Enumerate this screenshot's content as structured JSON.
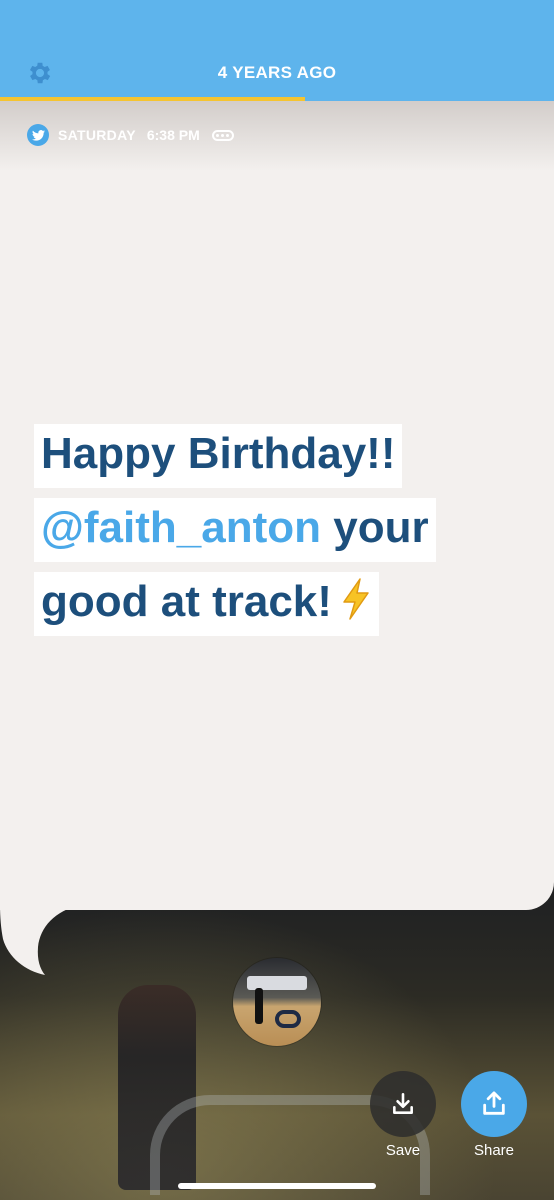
{
  "header": {
    "title": "4 YEARS AGO",
    "progress_percent": 55,
    "background_color": "#5eb4ec",
    "progress_color": "#f5c430",
    "settings_icon": "gear-icon"
  },
  "meta": {
    "source_icon": "twitter-icon",
    "day": "SATURDAY",
    "time": "6:38 PM",
    "more_icon": "ellipsis-icon"
  },
  "tweet": {
    "line1": "Happy Birthday!!",
    "mention": "@faith_anton",
    "line2_rest": " your",
    "line3": "good at track!",
    "emoji_icon": "lightning-bolt-icon",
    "text_color": "#1d4f7c",
    "mention_color": "#4aa8e8"
  },
  "actions": {
    "save_label": "Save",
    "save_icon": "download-icon",
    "share_label": "Share",
    "share_icon": "upload-icon"
  }
}
